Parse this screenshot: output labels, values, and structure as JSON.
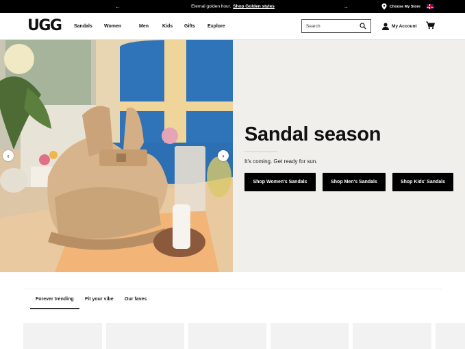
{
  "promo": {
    "message": "Eternal golden hour.",
    "link_label": "Shop Golden styles",
    "prev_icon": "arrow-left-icon",
    "next_icon": "arrow-right-icon",
    "store_label": "Choose My Store",
    "flag_icon": "uk-flag-icon"
  },
  "header": {
    "logo": "UGG",
    "nav": [
      "Sandals",
      "Women",
      "Men",
      "Kids",
      "Gifts",
      "Explore"
    ],
    "search_placeholder": "Search",
    "account_label": "My Account",
    "cart_icon": "cart-icon"
  },
  "hero": {
    "title": "Sandal season",
    "subtitle": "It's coming. Get ready for sun.",
    "buttons": [
      "Shop Women's Sandals",
      "Shop Men's Sandals",
      "Shop Kids' Sandals"
    ],
    "image_icon": "sandal-photo"
  },
  "tabs": [
    "Forever trending",
    "Fit your vibe",
    "Our faves"
  ],
  "colors": {
    "promo_bg": "#000000",
    "panel_bg": "#f1efeb",
    "button_bg": "#000000"
  }
}
